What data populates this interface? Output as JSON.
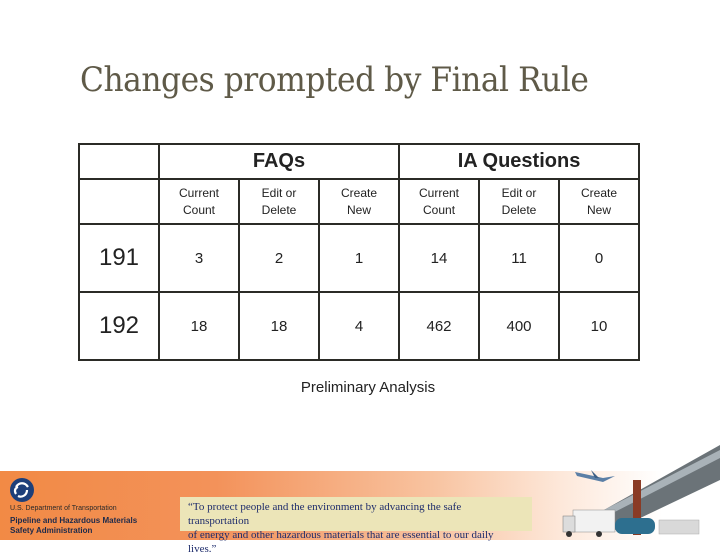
{
  "slide": {
    "title": "Changes prompted by Final Rule",
    "caption": "Preliminary Analysis"
  },
  "table": {
    "groups": [
      "FAQs",
      "IA Questions"
    ],
    "subheaders": [
      [
        "Current",
        "Count"
      ],
      [
        "Edit or",
        "Delete"
      ],
      [
        "Create",
        "New"
      ],
      [
        "Current",
        "Count"
      ],
      [
        "Edit or",
        "Delete"
      ],
      [
        "Create",
        "New"
      ]
    ],
    "rows": [
      {
        "label": "191",
        "values": [
          "3",
          "2",
          "1",
          "14",
          "11",
          "0"
        ]
      },
      {
        "label": "192",
        "values": [
          "18",
          "18",
          "4",
          "462",
          "400",
          "10"
        ]
      }
    ]
  },
  "footer": {
    "department": "U.S. Department of Transportation",
    "agency_line1": "Pipeline and Hazardous Materials",
    "agency_line2": "Safety Administration",
    "mission_line1": "“To protect people and the environment by advancing the safe transportation",
    "mission_line2": "of energy and other hazardous materials that are essential to our daily lives.”",
    "colors": {
      "banner": "#f28a45",
      "mission_box": "#ece5b8",
      "mission_text": "#1d2b6b",
      "logo": "#1d3f7a"
    }
  }
}
